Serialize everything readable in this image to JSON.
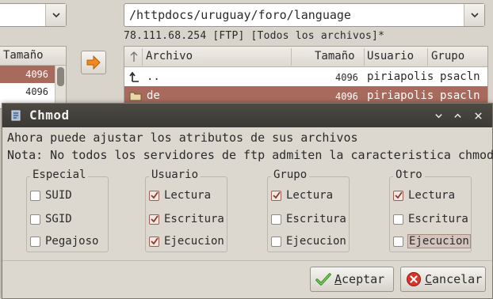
{
  "background": {
    "path": "/httpdocs/uruguay/foro/language",
    "status_line": "78.111.68.254 [FTP] [Todos los archivos]*",
    "left_pane": {
      "header": "Tamaño",
      "rows": [
        "4096",
        "4096"
      ]
    },
    "right_pane": {
      "columns": {
        "archivo": "Archivo",
        "tamano": "Tamaño",
        "usuario": "Usuario",
        "grupo": "Grupo"
      },
      "rows": [
        {
          "name": "..",
          "size": "4096",
          "user": "piriapolis",
          "group": "psacln",
          "icon": "up-arrow-icon"
        },
        {
          "name": "de",
          "size": "4096",
          "user": "piriapolis",
          "group": "psacln",
          "icon": "folder-icon"
        }
      ]
    }
  },
  "dialog": {
    "title": "Chmod",
    "line1": "Ahora puede ajustar los atributos de sus archivos",
    "line2": "Nota: No todos los servidores de ftp admiten la caracteristica chmod",
    "groups": [
      {
        "label": "Especial",
        "options": [
          {
            "label": "SUID",
            "checked": false
          },
          {
            "label": "SGID",
            "checked": false
          },
          {
            "label": "Pegajoso",
            "checked": false
          }
        ]
      },
      {
        "label": "Usuario",
        "options": [
          {
            "label": "Lectura",
            "checked": true
          },
          {
            "label": "Escritura",
            "checked": true
          },
          {
            "label": "Ejecucion",
            "checked": true
          }
        ]
      },
      {
        "label": "Grupo",
        "options": [
          {
            "label": "Lectura",
            "checked": true
          },
          {
            "label": "Escritura",
            "checked": false
          },
          {
            "label": "Ejecucion",
            "checked": false
          }
        ]
      },
      {
        "label": "Otro",
        "options": [
          {
            "label": "Lectura",
            "checked": true
          },
          {
            "label": "Escritura",
            "checked": false
          },
          {
            "label": "Ejecucion",
            "checked": false
          }
        ]
      }
    ],
    "accept_label_first": "A",
    "accept_label_rest": "ceptar",
    "cancel_label_first": "C",
    "cancel_label_rest": "ancelar"
  },
  "colors": {
    "selection": "#a86a5c",
    "titlebar": "#3f3d38",
    "dialog_bg": "#dcd7cf"
  }
}
